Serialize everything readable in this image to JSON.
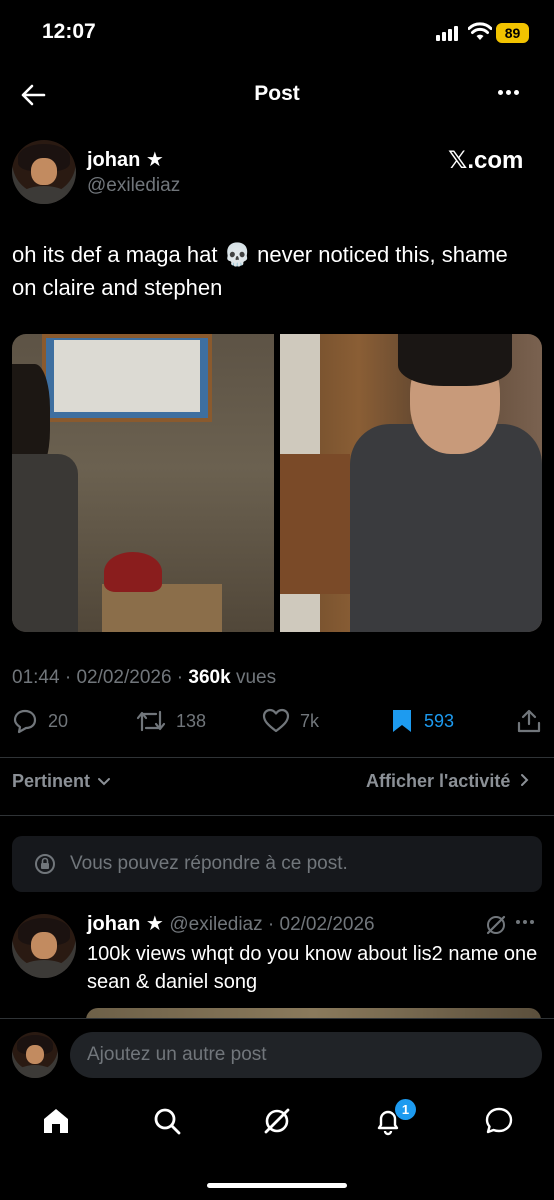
{
  "status_bar": {
    "time": "12:07",
    "battery": "89"
  },
  "header": {
    "title": "Post"
  },
  "post": {
    "author_name": "johan ★",
    "author_handle": "@exilediaz",
    "source": "𝕏.com",
    "text_part1": "oh its def a maga hat ",
    "emoji": "💀",
    "text_part2": " never noticed this, shame on claire and stephen",
    "time": "01:44",
    "date": "02/02/2026",
    "views_count": "360k",
    "views_label": "vues",
    "replies": "20",
    "reposts": "138",
    "likes": "7k",
    "bookmarks": "593"
  },
  "sort": {
    "label": "Pertinent",
    "activity": "Afficher l'activité"
  },
  "reply_notice": "Vous pouvez répondre à ce post.",
  "reply": {
    "author_name": "johan ★",
    "author_handle": "@exilediaz",
    "date": "02/02/2026",
    "text": "100k views whqt do you know about lis2 name one sean & daniel song"
  },
  "compose": {
    "placeholder": "Ajoutez un autre post"
  },
  "tabbar": {
    "notifications_badge": "1"
  },
  "colors": {
    "accent": "#1d9bf0",
    "background": "#000000",
    "muted": "#71767b",
    "battery": "#f2c300"
  }
}
